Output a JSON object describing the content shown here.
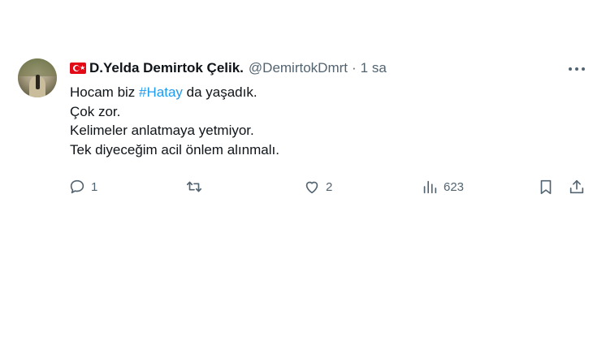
{
  "tweet": {
    "author": {
      "name": "D.Yelda Demirtok Çelik.",
      "handle": "@DemirtokDmrt"
    },
    "separator": "·",
    "time": "1 sa",
    "text": {
      "line1_prefix": "Hocam biz ",
      "hashtag": "#Hatay",
      "line1_suffix": " da yaşadık.",
      "line2": "Çok zor.",
      "line3": "Kelimeler anlatmaya yetmiyor.",
      "line4": "Tek diyeceğim acil önlem alınmalı."
    },
    "actions": {
      "reply_count": "1",
      "retweet_count": "",
      "like_count": "2",
      "views_count": "623"
    }
  },
  "colors": {
    "accent": "#1d9bf0",
    "secondary_text": "#536471",
    "primary_text": "#0f1419",
    "flag_red": "#e30a17"
  },
  "icons": {
    "flag": "turkey-flag-icon",
    "more": "more-horizontal-icon",
    "reply": "reply-icon",
    "retweet": "retweet-icon",
    "like": "heart-icon",
    "views": "views-chart-icon",
    "bookmark": "bookmark-icon",
    "share": "share-icon"
  }
}
